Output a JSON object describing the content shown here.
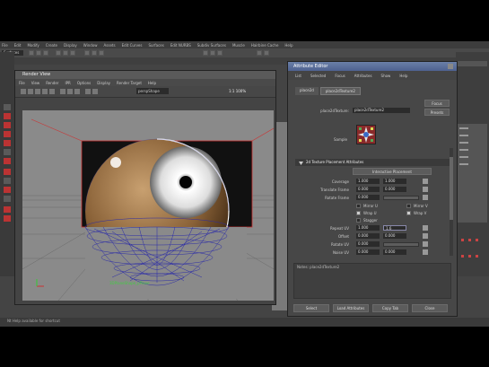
{
  "app": {
    "menus": [
      "File",
      "Edit",
      "Modify",
      "Create",
      "Display",
      "Window",
      "Assets",
      "Edit Curves",
      "Surfaces",
      "Edit NURBS",
      "Subdiv Surfaces",
      "Muscle",
      "Hairbine Cache",
      "Help"
    ],
    "mode": "Surfaces",
    "status_text": "Nt Help available for shortcut"
  },
  "render_view": {
    "title": "Render View",
    "menus": [
      "File",
      "View",
      "Render",
      "IPR",
      "Options",
      "Display",
      "Render Target",
      "Help"
    ],
    "camera_combo": "perspShape",
    "zoom": "1:1 100%",
    "camera_label": "3DPlaneShape_pPlane"
  },
  "attribute_editor": {
    "title": "Attribute Editor",
    "menus": [
      "List",
      "Selected",
      "Focus",
      "Attributes",
      "Show",
      "Help"
    ],
    "tabs": [
      "place2d",
      "place2dTexture2"
    ],
    "texture_label": "place2dTexture:",
    "texture_value": "place2dTexture2",
    "focus_button": "Focus",
    "presets_button": "Presets",
    "sample_label": "Sample",
    "section_title": "2d Texture Placement Attributes",
    "interactive_button": "Interactive Placement",
    "rows": [
      {
        "label": "Coverage",
        "v1": "1.000",
        "v2": "1.000"
      },
      {
        "label": "Translate Frame",
        "v1": "0.000",
        "v2": "0.000"
      },
      {
        "label": "Rotate Frame",
        "v1": "0.000",
        "v2": ""
      }
    ],
    "checks": [
      {
        "label": "Mirror U",
        "label2": "Mirror V"
      },
      {
        "label": "Wrap U",
        "label2": "Wrap V"
      },
      {
        "label": "Stagger",
        "label2": ""
      }
    ],
    "rows2": [
      {
        "label": "Repeat UV",
        "v1": "1.000",
        "v2": "1.6"
      },
      {
        "label": "Offset",
        "v1": "0.000",
        "v2": "0.000"
      },
      {
        "label": "Rotate UV",
        "v1": "0.000",
        "v2": ""
      },
      {
        "label": "Noise UV",
        "v1": "0.000",
        "v2": "0.000"
      }
    ],
    "notes_label": "Notes: place2dTexture2",
    "footer": [
      "Select",
      "Load Attributes",
      "Copy Tab",
      "Close"
    ]
  }
}
